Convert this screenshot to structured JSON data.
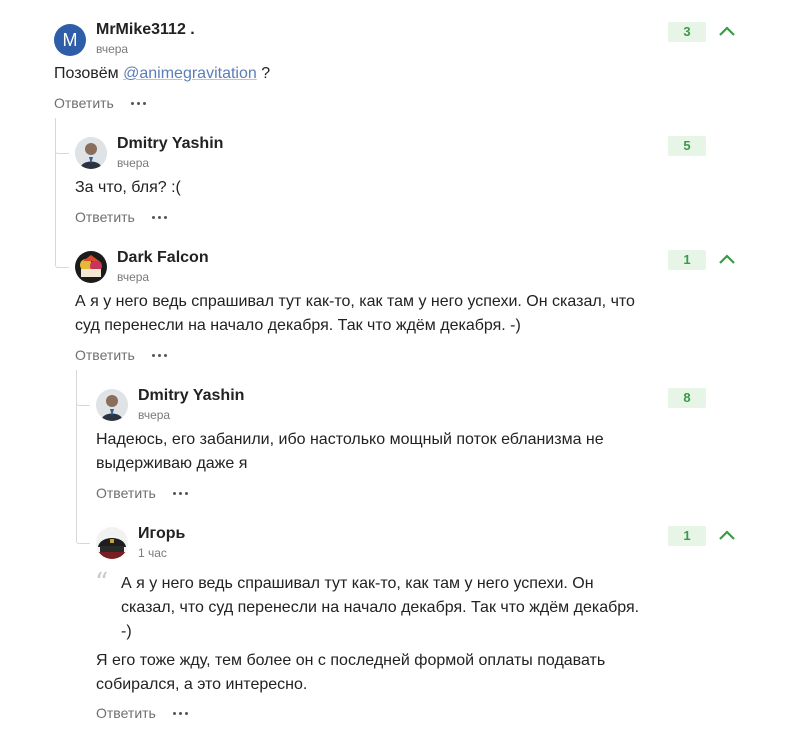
{
  "actions": {
    "reply_label": "Ответить"
  },
  "colors": {
    "score_bg": "#e7f5e7",
    "score_text": "#3a9a45",
    "mention": "#5c7db8",
    "avatar_letter_bg": "#2f5ea8"
  },
  "comments": [
    {
      "author": "MrMike3112 .",
      "avatar_letter": "M",
      "time": "вчера",
      "text_before": "Позовём ",
      "mention": "@animegravitation",
      "text_after": " ?",
      "score": "3"
    },
    {
      "author": "Dmitry Yashin",
      "time": "вчера",
      "text": "За что, бля? :(",
      "score": "5"
    },
    {
      "author": "Dark Falcon",
      "time": "вчера",
      "text": "А я у него ведь спрашивал тут как-то, как там у него успехи. Он сказал, что суд перенесли на начало декабря. Так что ждём декабря. -)",
      "score": "1"
    },
    {
      "author": "Dmitry Yashin",
      "time": "вчера",
      "text": "Надеюсь, его забанили, ибо настолько мощный поток ебланизма не выдерживаю даже я",
      "score": "8"
    },
    {
      "author": "Игорь",
      "time": "1 час",
      "quote_mark": "“",
      "quote": "А я у него ведь спрашивал тут как-то, как там у него успехи. Он сказал, что суд перенесли на начало декабря. Так что ждём декабря. -)",
      "text": "Я его тоже жду, тем более он с последней формой оплаты подавать собирался, а это интересно.",
      "score": "1"
    }
  ]
}
